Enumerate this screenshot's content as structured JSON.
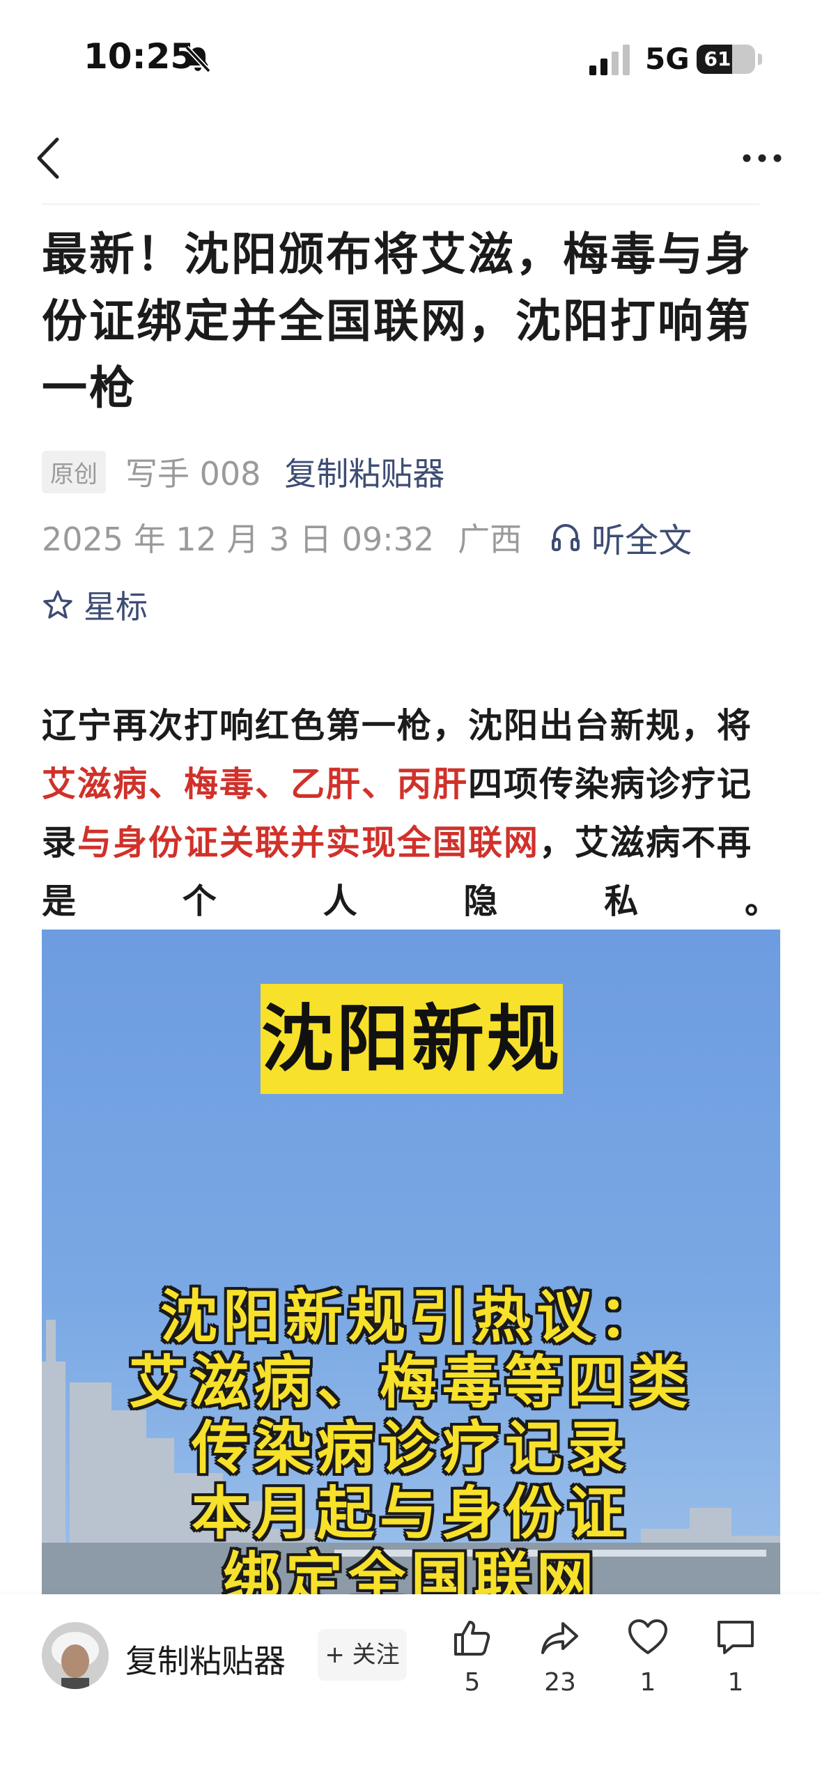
{
  "status_bar": {
    "time": "10:25",
    "network": "5G",
    "battery": "61",
    "battery_level": 0.61
  },
  "nav": {
    "back_icon": "chevron-left-icon",
    "more_icon": "more-dots-icon"
  },
  "article": {
    "title": "最新！沈阳颁布将艾滋，梅毒与身份证绑定并全国联网，沈阳打响第一枪",
    "badge": "原创",
    "author": "写手 008",
    "account": "复制粘贴器",
    "date": "2025 年 12 月 3 日 09:32",
    "region": "广西",
    "listen_label": "听全文",
    "star_label": "星标",
    "paragraph": {
      "p1": "辽宁再次打响红色第一枪，沈阳出台新规，将",
      "r1": "艾滋病、梅毒、乙肝、丙肝",
      "p2": "四项传染病诊疗记录",
      "r2": "与身份证关联并实现全国联网",
      "p3": "，艾滋病不再",
      "last_line": [
        "是",
        "个",
        "人",
        "隐",
        "私",
        "。"
      ]
    },
    "image": {
      "banner": "沈阳新规",
      "caption": [
        "沈阳新规引热议：",
        "艾滋病、梅毒等四类",
        "传染病诊疗记录",
        "本月起与身份证",
        "绑定全国联网"
      ]
    }
  },
  "bottom_bar": {
    "account_name": "复制粘贴器",
    "follow_label": "+ 关注",
    "actions": [
      {
        "icon": "thumbs-up-icon",
        "count": "5"
      },
      {
        "icon": "share-icon",
        "count": "23"
      },
      {
        "icon": "heart-icon",
        "count": "1"
      },
      {
        "icon": "comment-icon",
        "count": "1"
      }
    ]
  },
  "colors": {
    "accent_red": "#d0312a",
    "link_blue": "#3d4c73",
    "banner_yellow": "#f7e12a"
  }
}
